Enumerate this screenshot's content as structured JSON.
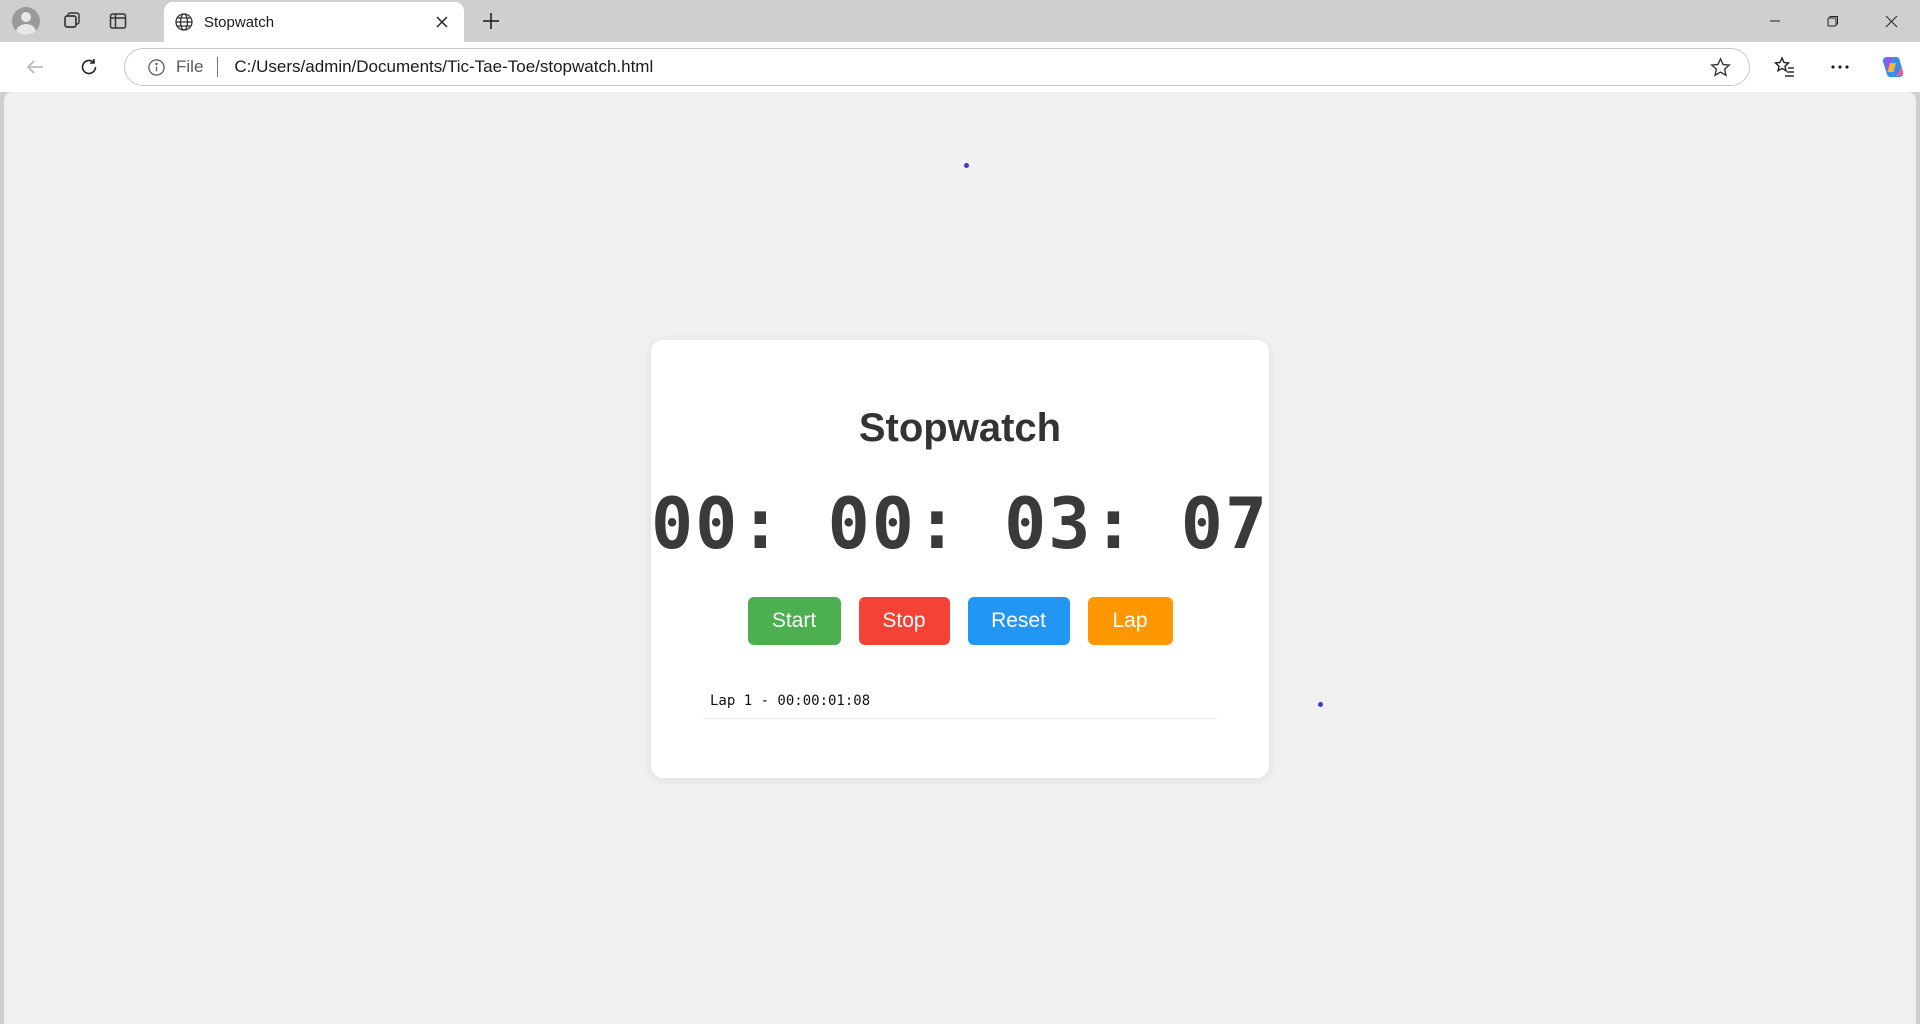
{
  "browser": {
    "tab_title": "Stopwatch",
    "address": {
      "scheme_label": "File",
      "url": "C:/Users/admin/Documents/Tic-Tae-Toe/stopwatch.html"
    }
  },
  "app": {
    "title": "Stopwatch",
    "display": "00: 00: 03: 07",
    "buttons": {
      "start": "Start",
      "stop": "Stop",
      "reset": "Reset",
      "lap": "Lap"
    },
    "laps": [
      "Lap 1 - 00:00:01:08"
    ],
    "colors": {
      "start": "#4caf50",
      "stop": "#f44336",
      "reset": "#2196f3",
      "lap": "#ff9800"
    }
  }
}
